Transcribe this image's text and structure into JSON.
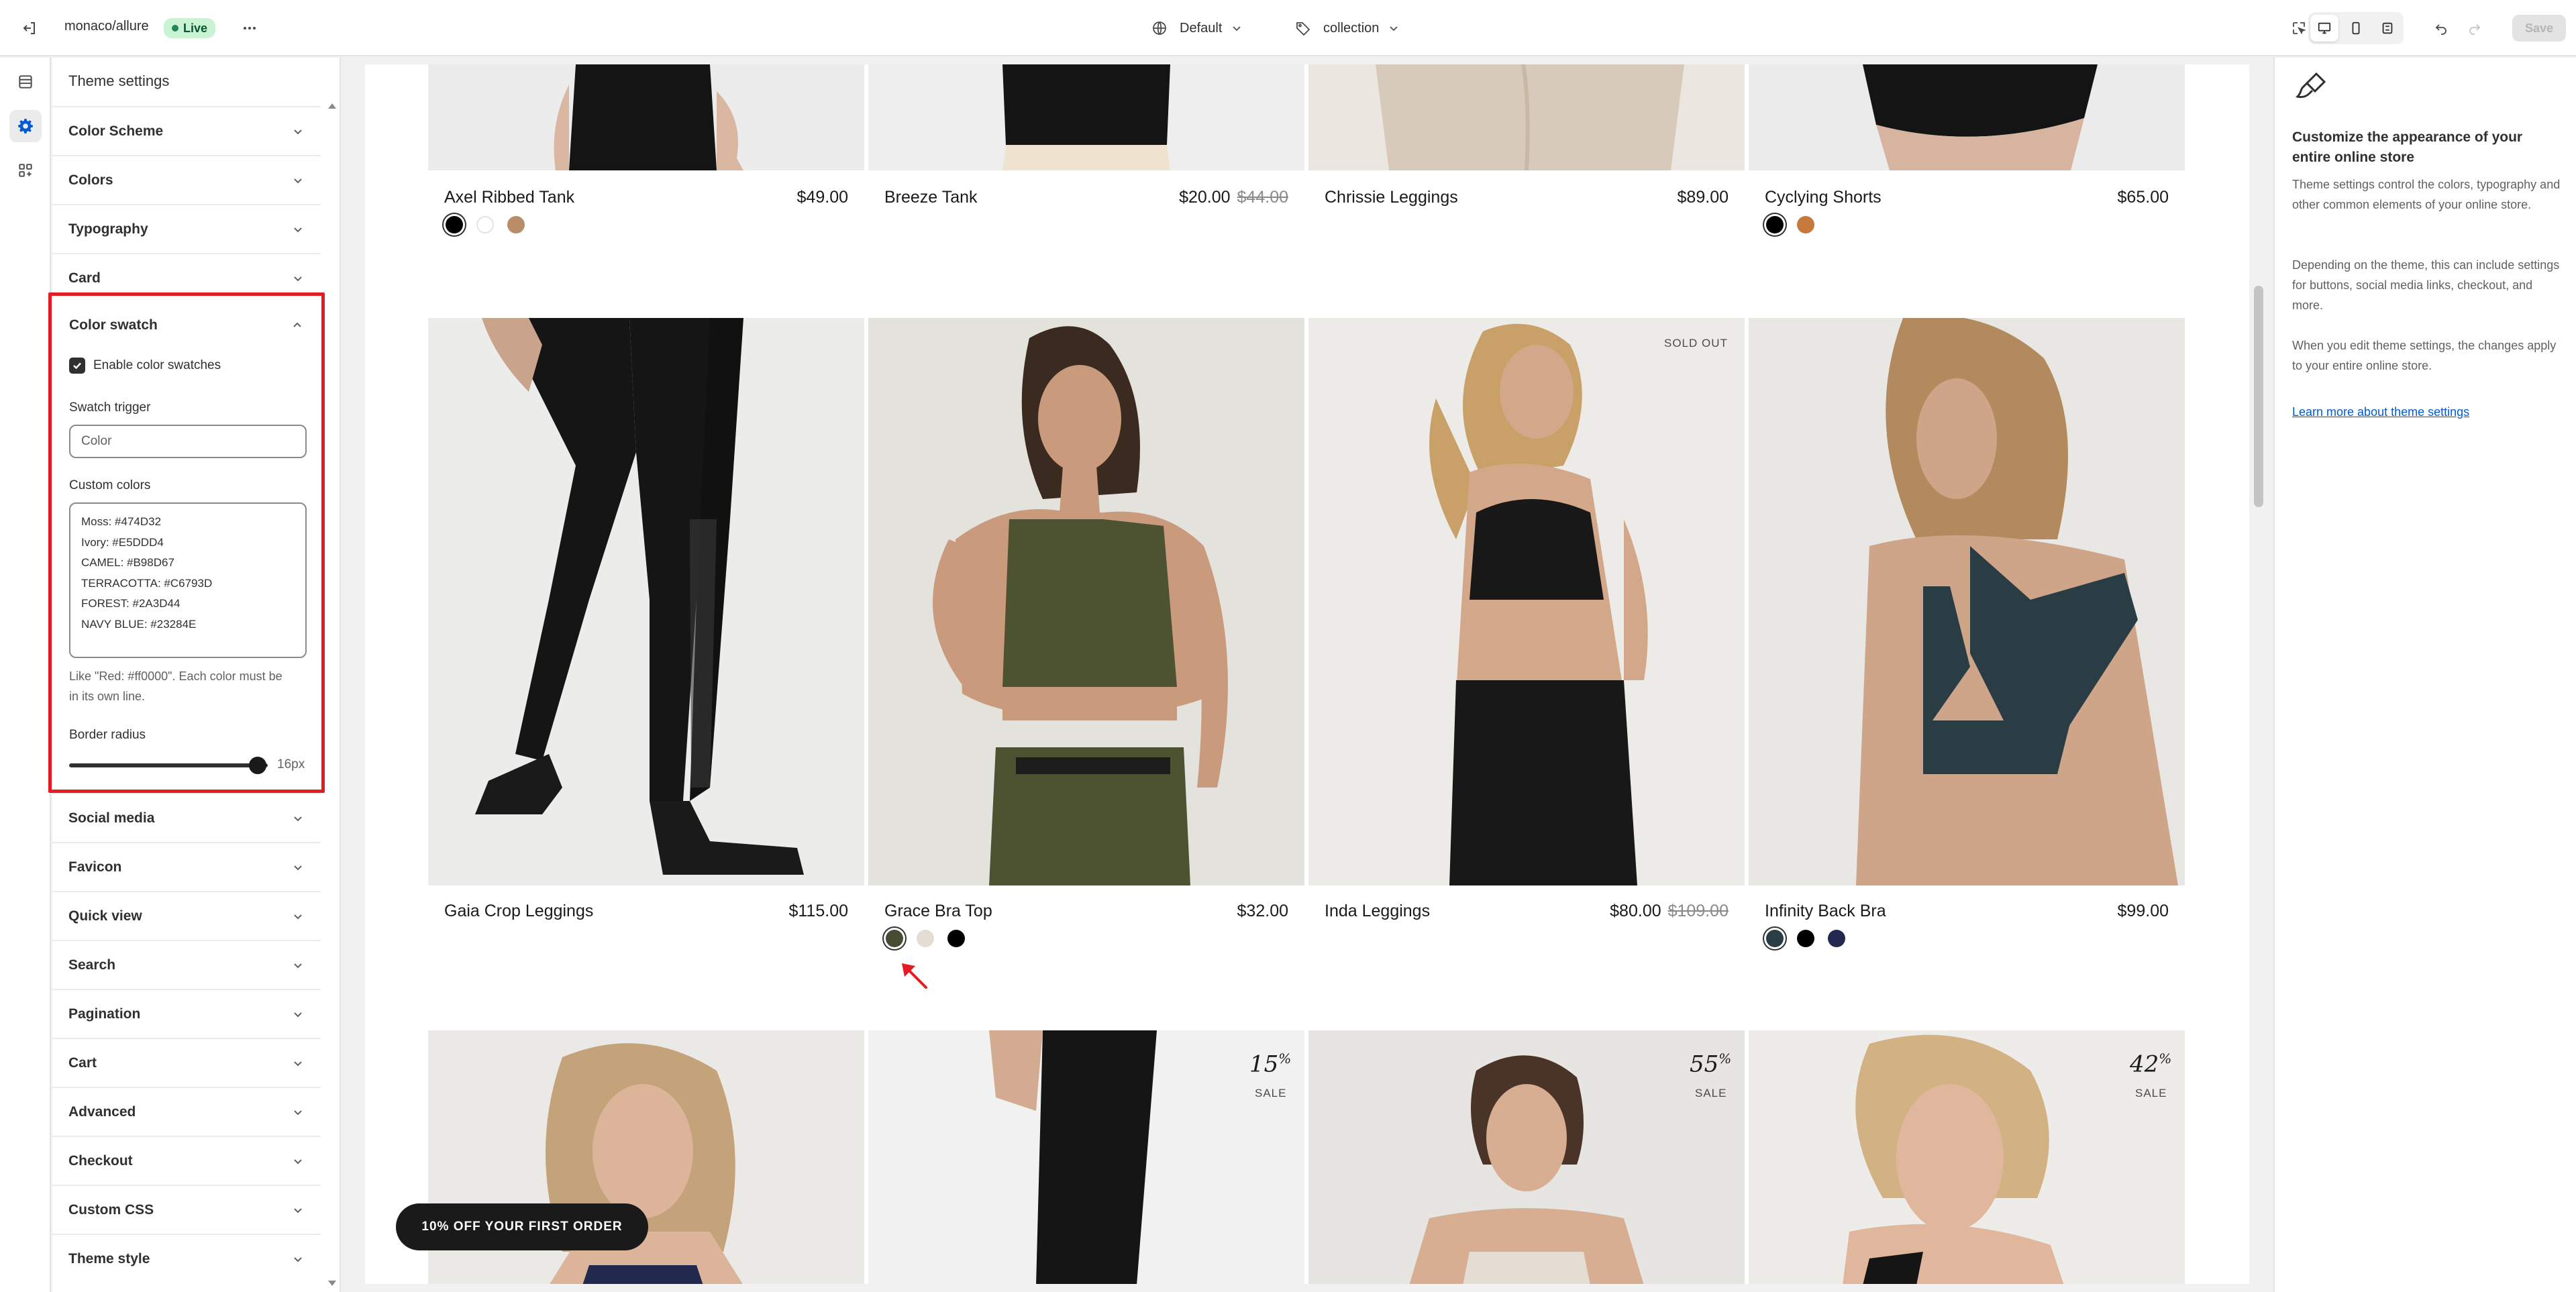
{
  "topbar": {
    "store_name": "monaco/allure",
    "status_badge": "Live",
    "theme_select": "Default",
    "template_select": "collection",
    "save_label": "Save"
  },
  "panel": {
    "title": "Theme settings",
    "sections_top": [
      "Color Scheme",
      "Colors",
      "Typography",
      "Card"
    ],
    "sections_bottom": [
      "Social media",
      "Favicon",
      "Quick view",
      "Search",
      "Pagination",
      "Cart",
      "Advanced",
      "Checkout",
      "Custom CSS",
      "Theme style"
    ],
    "color_swatch": {
      "title": "Color swatch",
      "enable_label": "Enable color swatches",
      "enabled": true,
      "trigger_label": "Swatch trigger",
      "trigger_value": "Color",
      "custom_colors_label": "Custom colors",
      "custom_colors_lines": [
        "Moss: #474D32",
        "Ivory: #E5DDD4",
        "CAMEL: #B98D67",
        "TERRACOTTA: #C6793D",
        "FOREST: #2A3D44",
        "NAVY BLUE: #23284E"
      ],
      "help_line1": "Like \"Red: #ff0000\". Each color must be",
      "help_line2": "in its own line.",
      "border_radius_label": "Border radius",
      "border_radius_value": "16px",
      "border_radius_fraction": 0.95
    }
  },
  "products_row1": [
    {
      "name": "Axel Ribbed Tank",
      "price": "$49.00",
      "compare": "",
      "swatches": [
        "#000000",
        "#ffffff",
        "#B98D67"
      ]
    },
    {
      "name": "Breeze Tank",
      "price": "$20.00",
      "compare": "$44.00",
      "swatches": []
    },
    {
      "name": "Chrissie Leggings",
      "price": "$89.00",
      "compare": "",
      "swatches": []
    },
    {
      "name": "Cyclying Shorts",
      "price": "$65.00",
      "compare": "",
      "swatches": [
        "#000000",
        "#C6793D"
      ]
    }
  ],
  "products_row2": [
    {
      "name": "Gaia Crop Leggings",
      "price": "$115.00",
      "compare": "",
      "swatches": []
    },
    {
      "name": "Grace Bra Top",
      "price": "$32.00",
      "compare": "",
      "swatches": [
        "#474D32",
        "#E5DDD4",
        "#000000"
      ]
    },
    {
      "name": "Inda Leggings",
      "price": "$80.00",
      "compare": "$109.00",
      "badge": "SOLD OUT",
      "swatches": []
    },
    {
      "name": "Infinity Back Bra",
      "price": "$99.00",
      "compare": "",
      "swatches": [
        "#2A3D44",
        "#000000",
        "#23284E"
      ]
    }
  ],
  "products_row3_badges": [
    {
      "pct": "",
      "label": ""
    },
    {
      "pct": "15",
      "label": "SALE"
    },
    {
      "pct": "55",
      "label": "SALE"
    },
    {
      "pct": "42",
      "label": "SALE"
    }
  ],
  "promo_button": "10% OFF YOUR FIRST ORDER",
  "info": {
    "title": "Customize the appearance of your entire online store",
    "p1": "Theme settings control the colors, typography and other common elements of your online store.",
    "p2": "Depending on the theme, this can include settings for buttons, social media links, checkout, and more.",
    "p3": "When you edit theme settings, the changes apply to your entire online store.",
    "link": "Learn more about theme settings"
  },
  "colors": {
    "highlight_border": "#e31b23",
    "live_badge_bg": "#c9f3d3",
    "link": "#005bd3",
    "annotation_arrow": "#e31b23"
  }
}
